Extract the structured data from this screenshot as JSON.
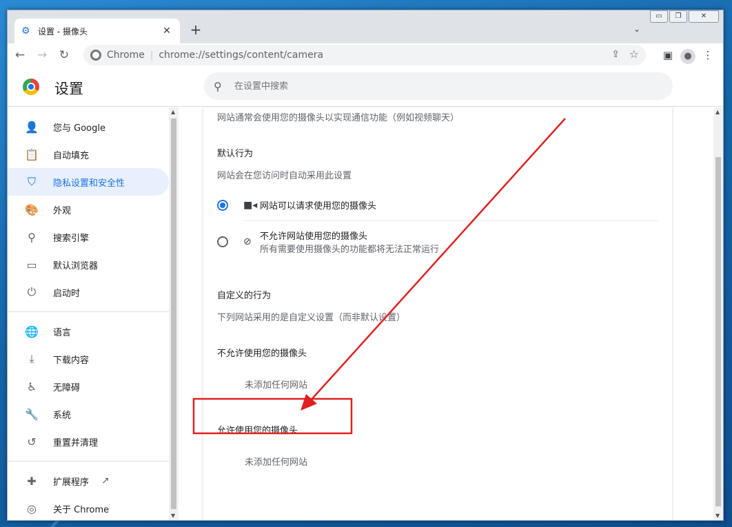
{
  "tab": {
    "title": "设置 - 摄像头",
    "icon": "gear-icon"
  },
  "omnibox": {
    "site_label": "Chrome",
    "url": "chrome://settings/content/camera"
  },
  "header": {
    "title": "设置",
    "search_placeholder": "在设置中搜索"
  },
  "sidebar": {
    "items": [
      {
        "label": "您与 Google",
        "icon": "person-icon"
      },
      {
        "label": "自动填充",
        "icon": "clipboard-icon"
      },
      {
        "label": "隐私设置和安全性",
        "icon": "shield-icon",
        "active": true
      },
      {
        "label": "外观",
        "icon": "palette-icon"
      },
      {
        "label": "搜索引擎",
        "icon": "search-icon"
      },
      {
        "label": "默认浏览器",
        "icon": "browser-icon"
      },
      {
        "label": "启动时",
        "icon": "power-icon"
      },
      {
        "label": "语言",
        "icon": "globe-icon"
      },
      {
        "label": "下载内容",
        "icon": "download-icon"
      },
      {
        "label": "无障碍",
        "icon": "accessibility-icon"
      },
      {
        "label": "系统",
        "icon": "wrench-icon"
      },
      {
        "label": "重置并清理",
        "icon": "reset-icon"
      },
      {
        "label": "扩展程序",
        "icon": "puzzle-icon"
      },
      {
        "label": "关于 Chrome",
        "icon": "chrome-icon"
      }
    ]
  },
  "content": {
    "intro": "网站通常会使用您的摄像头以实现通信功能（例如视频聊天）",
    "default_behavior": {
      "heading": "默认行为",
      "description": "网站会在您访问时自动采用此设置",
      "option_allow": "网站可以请求使用您的摄像头",
      "option_block": "不允许网站使用您的摄像头",
      "option_block_sub": "所有需要使用摄像头的功能都将无法正常运行",
      "selected": "allow"
    },
    "custom_behavior": {
      "heading": "自定义的行为",
      "description": "下列网站采用的是自定义设置（而非默认设置）",
      "blocked_heading": "不允许使用您的摄像头",
      "blocked_empty": "未添加任何网站",
      "allowed_heading": "允许使用您的摄像头",
      "allowed_empty": "未添加任何网站"
    }
  },
  "annotation": {
    "color": "#e02020"
  }
}
